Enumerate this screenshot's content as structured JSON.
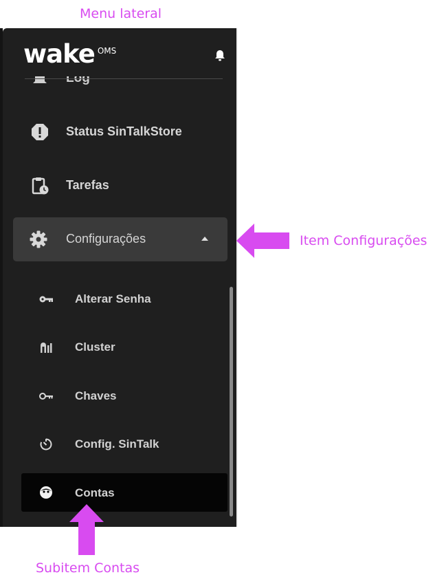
{
  "annotations": {
    "top": "Menu lateral",
    "middle": "Item Configurações",
    "bottom": "Subitem Contas"
  },
  "brand": {
    "name": "wake",
    "suffix": "OMS"
  },
  "colors": {
    "accent": "#d84bf0",
    "sidebar_bg": "#1f1f1f",
    "brand_mark": "#a13cf0"
  },
  "menu": {
    "partial_item": {
      "label": "Log",
      "icon": "bell-icon"
    },
    "items": [
      {
        "label": "Status SinTalkStore",
        "icon": "alert-octagon-icon"
      },
      {
        "label": "Tarefas",
        "icon": "clipboard-clock-icon"
      }
    ],
    "expanded": {
      "label": "Configurações",
      "icon": "gear-icon",
      "subitems": [
        {
          "label": "Alterar Senha",
          "icon": "key-icon"
        },
        {
          "label": "Cluster",
          "icon": "cluster-icon"
        },
        {
          "label": "Chaves",
          "icon": "key-outline-icon"
        },
        {
          "label": "Config. SinTalk",
          "icon": "timer-icon"
        },
        {
          "label": "Contas",
          "icon": "account-face-icon"
        }
      ]
    }
  }
}
